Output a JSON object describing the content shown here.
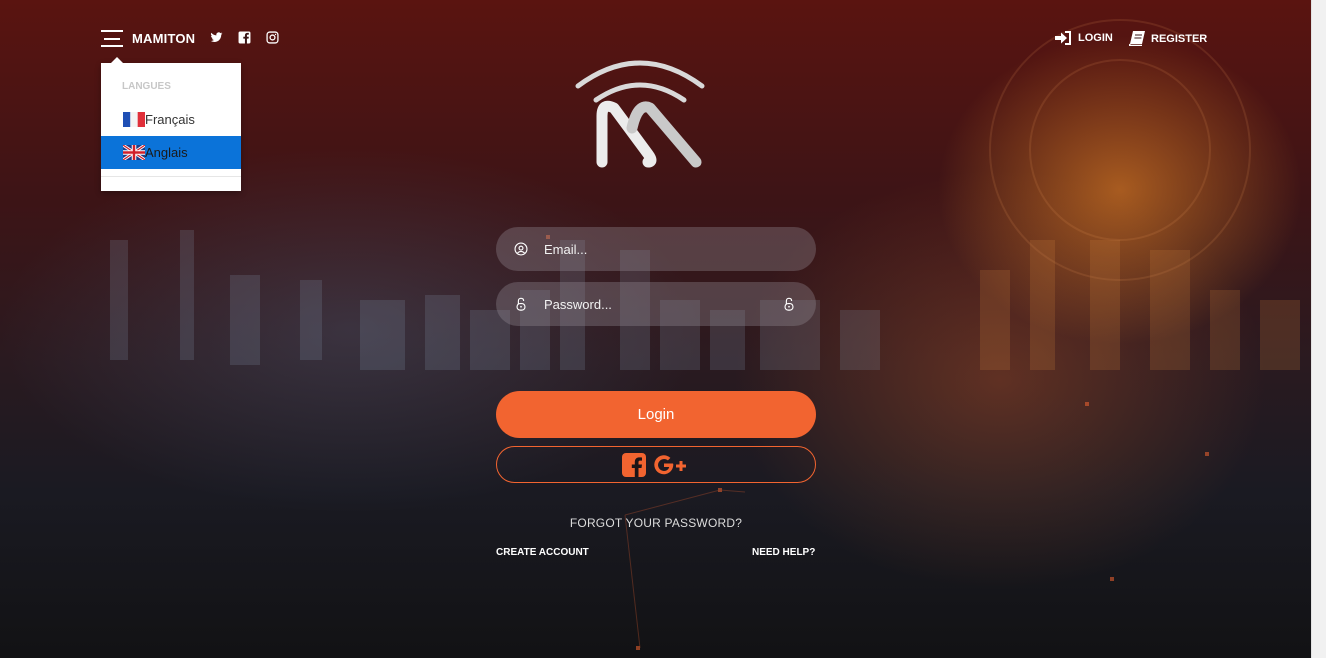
{
  "header": {
    "brand": "MAMITON",
    "menu_icon": "hamburger-icon",
    "social": [
      "twitter-icon",
      "facebook-icon",
      "instagram-icon"
    ],
    "login_label": "LOGIN",
    "register_label": "REGISTER"
  },
  "language_menu": {
    "heading": "LANGUES",
    "items": [
      {
        "label": "Français",
        "flag": "france-flag-icon",
        "selected": false
      },
      {
        "label": "Anglais",
        "flag": "uk-flag-icon",
        "selected": true
      }
    ]
  },
  "form": {
    "email_placeholder": "Email...",
    "password_placeholder": "Password...",
    "login_button": "Login",
    "social_buttons": [
      "facebook-icon",
      "google-plus-icon"
    ],
    "forgot_password": "FORGOT YOUR PASSWORD?",
    "create_account": "CREATE ACCOUNT",
    "need_help": "NEED HELP?"
  },
  "colors": {
    "accent": "#f26430",
    "selected_item": "#0b73d9"
  }
}
